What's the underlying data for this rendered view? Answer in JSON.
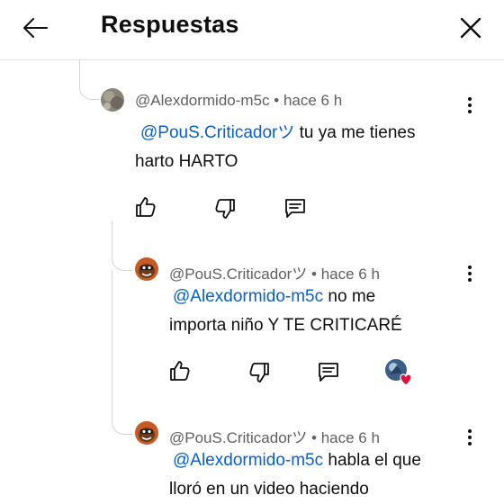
{
  "header": {
    "title": "Respuestas"
  },
  "comments": [
    {
      "author": "@Alexdormido-m5c",
      "time": "hace 6 h",
      "mention": "@PouS.Criticadorツ",
      "line1_rest": " tu ya me tienes",
      "line2": "harto HARTO"
    },
    {
      "author": "@PouS.Criticadorツ",
      "time": "hace 6 h",
      "mention": "@Alexdormido-m5c",
      "line1_rest": " no me",
      "line2": "importa niño Y TE CRITICARÉ"
    },
    {
      "author": "@PouS.Criticadorツ",
      "time": "hace 6 h",
      "mention": "@Alexdormido-m5c",
      "line1_rest": " habla el que",
      "line2": "lloró en un video haciendo"
    }
  ],
  "separator": " • ",
  "colors": {
    "mention": "#065fd4",
    "meta": "#606060",
    "heart": "#e0123d"
  }
}
